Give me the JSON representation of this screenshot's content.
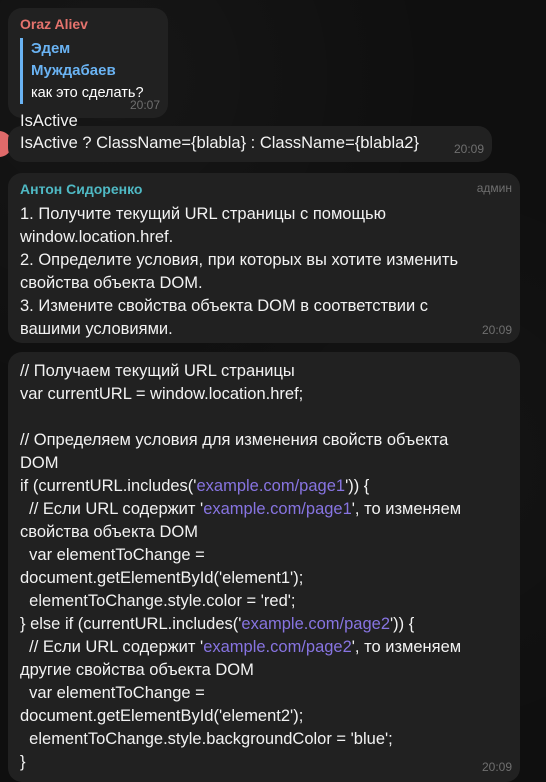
{
  "messages": {
    "m1": {
      "sender": "Oraz Aliev",
      "reply_name": "Эдем Муждабаев",
      "reply_text": "как это сделать?",
      "text": "IsActive",
      "time": "20:07",
      "sender_color": "#e5736d"
    },
    "m2": {
      "text": "IsActive ? ClassName={blabla} : ClassName={blabla2}",
      "time": "20:09"
    },
    "m3": {
      "sender": "Антон Сидоренко",
      "badge": "админ",
      "sender_color": "#4fb9c4",
      "text": "1. Получите текущий URL страницы с помощью\nwindow.location.href.\n2. Определите условия, при которых вы хотите изменить\nсвойства объекта DOM.\n3. Измените свойства объекта DOM в соответствии с\nвашими условиями.",
      "time": "20:09"
    },
    "m4": {
      "l1": "// Получаем текущий URL страницы",
      "l2": "var currentURL = window.location.href;",
      "l3": "// Определяем условия для изменения свойств объекта",
      "l4": "DOM",
      "l5a": "if (currentURL.includes('",
      "link1": "example.com/page1",
      "l5b": "')) {",
      "l6a": "  // Если URL содержит '",
      "link2": "example.com/page1",
      "l6b": "', то изменяем",
      "l7": "свойства объекта DOM",
      "l8": "  var elementToChange =",
      "l9": "document.getElementById('element1');",
      "l10": "  elementToChange.style.color = 'red';",
      "l11a": "} else if (currentURL.includes('",
      "link3": "example.com/page2",
      "l11b": "')) {",
      "l12a": "  // Если URL содержит '",
      "link4": "example.com/page2",
      "l12b": "', то изменяем",
      "l13": "другие свойства объекта DOM",
      "l14": "  var elementToChange =",
      "l15": "document.getElementById('element2');",
      "l16": "  elementToChange.style.backgroundColor = 'blue';",
      "l17": "}",
      "time": "20:09"
    }
  }
}
